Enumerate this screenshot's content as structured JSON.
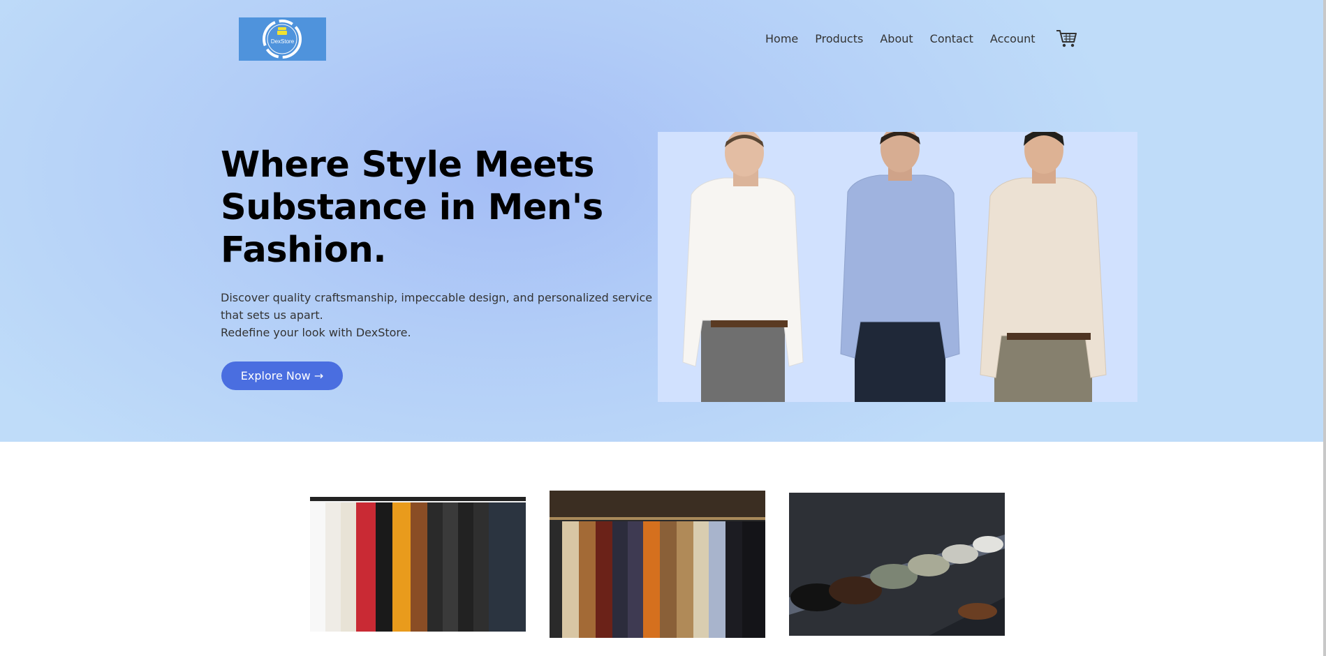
{
  "brand": {
    "logo_text": "DexStore"
  },
  "nav": {
    "items": [
      "Home",
      "Products",
      "About",
      "Contact",
      "Account"
    ],
    "cart_icon": "cart-icon"
  },
  "hero": {
    "headline_lines": [
      "Where Style Meets",
      "Substance in Men's",
      "Fashion."
    ],
    "description_lines": [
      "Discover quality craftsmanship, impeccable design, and personalized service",
      "that sets us apart.",
      "Redefine your look with DexStore."
    ],
    "cta_label": "Explore Now →"
  },
  "colors": {
    "accent": "#4a6ee0",
    "logo_bg": "#4f93dc",
    "hero_bg": "#b2cdf7",
    "models_bg": "#d1e1fe"
  }
}
